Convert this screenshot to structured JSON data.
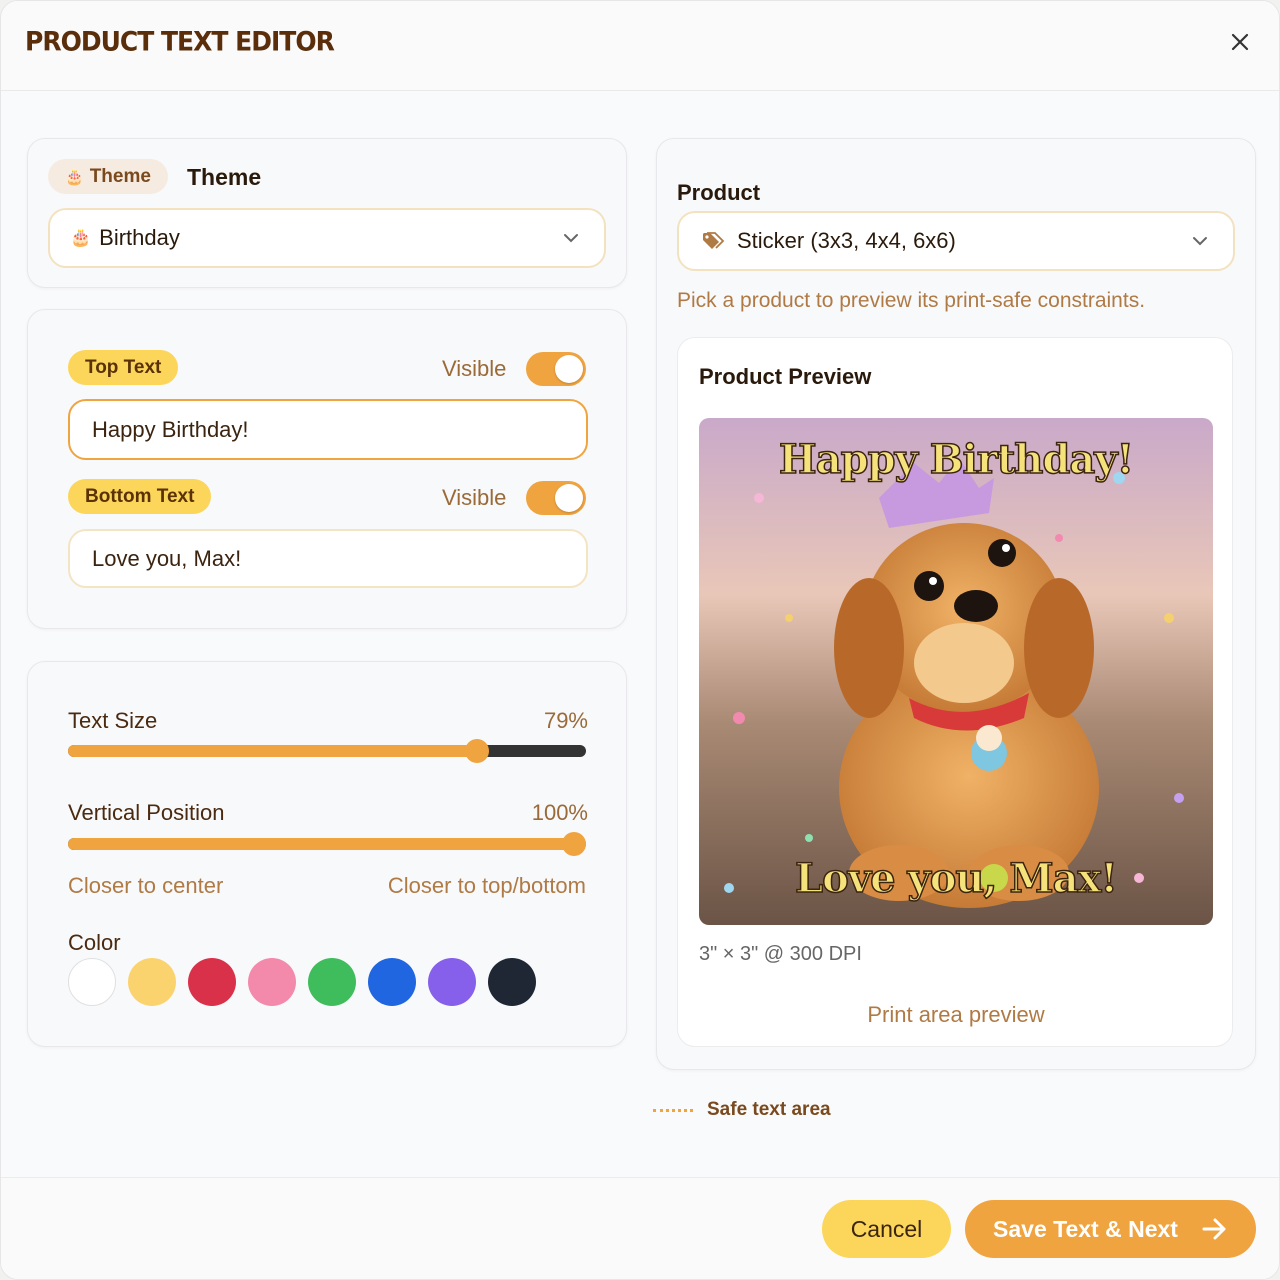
{
  "header": {
    "title": "Product Text Editor"
  },
  "theme": {
    "pill_label": "Theme",
    "heading": "Theme",
    "selected": "Birthday",
    "icon": "cake-icon"
  },
  "text_panel": {
    "top": {
      "pill": "Top Text",
      "visible_label": "Visible",
      "visible": true,
      "value": "Happy Birthday!"
    },
    "bottom": {
      "pill": "Bottom Text",
      "visible_label": "Visible",
      "visible": true,
      "value": "Love you, Max!"
    }
  },
  "style_panel": {
    "text_size": {
      "label": "Text Size",
      "value_text": "79%",
      "value": 0.79
    },
    "vertical_position": {
      "label": "Vertical Position",
      "value_text": "100%",
      "value": 1.0
    },
    "hint_left": "Closer to center",
    "hint_right": "Closer to top/bottom",
    "color_label": "Color",
    "colors": [
      "#ffffff",
      "#fbd36e",
      "#d93149",
      "#f38aab",
      "#3fbd5d",
      "#1f66e0",
      "#8660ea",
      "#1e2733"
    ]
  },
  "product": {
    "label": "Product",
    "selected": "Sticker (3x3, 4x4, 6x6)",
    "helper": "Pick a product to preview its print-safe constraints.",
    "preview_title": "Product Preview",
    "overlay_top": "Happy Birthday!",
    "overlay_bottom": "Love you, Max!",
    "dimensions": "3\" × 3\" @ 300 DPI",
    "print_area": "Print area preview"
  },
  "legend": {
    "safe_area": "Safe text area"
  },
  "footer": {
    "cancel": "Cancel",
    "save": "Save Text & Next"
  },
  "colors": {
    "accent": "#f0a440",
    "brand_dark": "#5a2e0a",
    "pill_yellow": "#fbd65a"
  }
}
